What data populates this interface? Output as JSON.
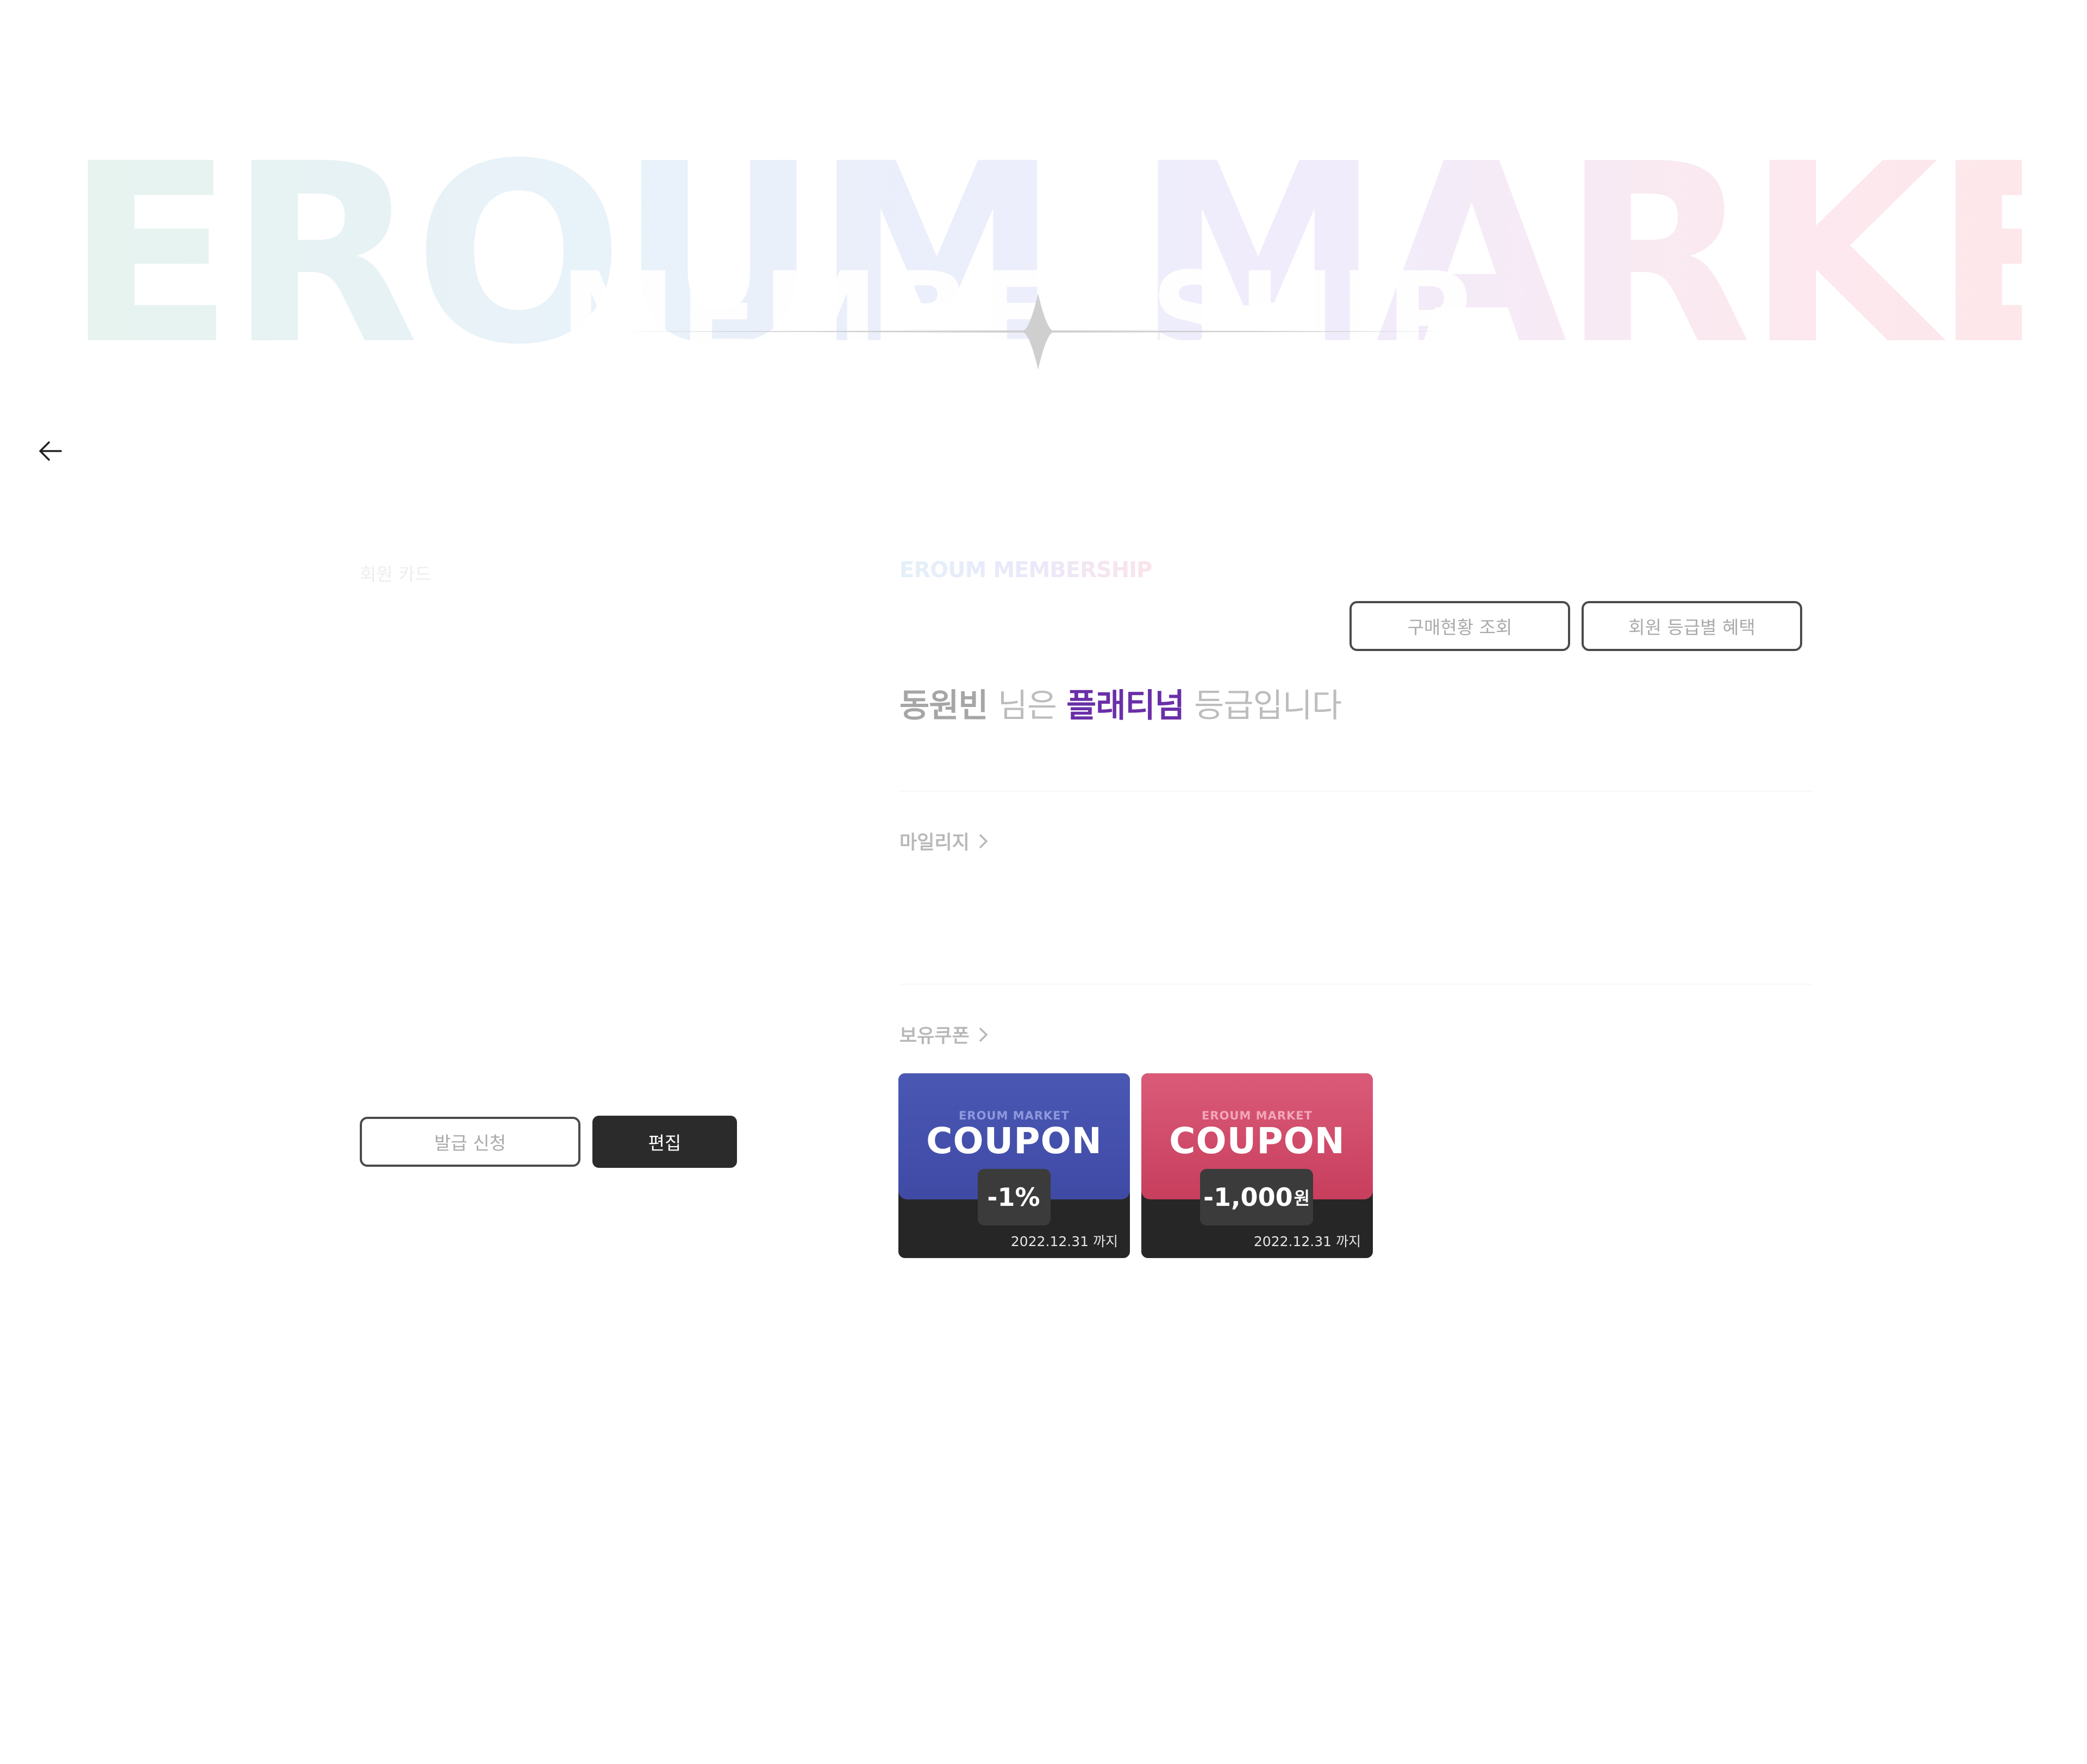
{
  "hero": {
    "background_text": "EROUM MARKET",
    "foreground_text": "MEMBERSHIP"
  },
  "nav": {
    "back_icon": "arrow-left-icon"
  },
  "card_panel": {
    "label": "회원 카드",
    "issue_button": "발급 신청",
    "edit_button": "편집"
  },
  "membership": {
    "brand_label": "EROUM MEMBERSHIP",
    "purchase_button": "구매현황 조회",
    "benefits_button": "회원 등급별 혜택",
    "grade": {
      "name": "동원빈",
      "text_mid": " 님은 ",
      "level": "플래티넘",
      "text_end": " 등급입니다",
      "level_color": "#6a2fa8"
    },
    "mileage_label": "마일리지",
    "coupons_label": "보유쿠폰",
    "coupons": [
      {
        "brand": "EROUM MARKET",
        "title": "COUPON",
        "discount": "-1%",
        "unit": "",
        "expiry": "2022.12.31 까지",
        "color": "#4550ab"
      },
      {
        "brand": "EROUM MARKET",
        "title": "COUPON",
        "discount": "-1,000",
        "unit": "원",
        "expiry": "2022.12.31 까지",
        "color": "#cf4766"
      }
    ]
  }
}
